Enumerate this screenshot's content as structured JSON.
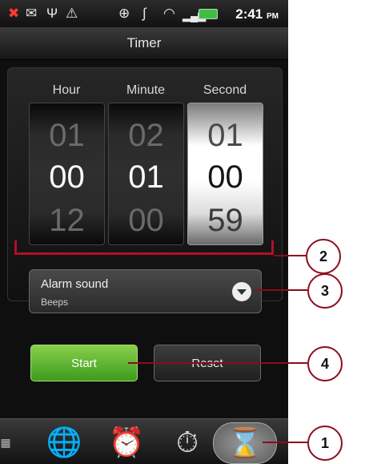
{
  "status_bar": {
    "time": "2:41",
    "ampm": "PM",
    "icons": [
      "missed-call-icon",
      "mail-icon",
      "usb-icon",
      "warning-icon",
      "gps-icon",
      "vibrate-icon",
      "wifi-icon",
      "signal-icon",
      "battery-icon"
    ]
  },
  "title": "Timer",
  "picker": {
    "columns": [
      {
        "label": "Hour",
        "above": "01",
        "value": "00",
        "below": "12"
      },
      {
        "label": "Minute",
        "above": "02",
        "value": "01",
        "below": "00"
      },
      {
        "label": "Second",
        "above": "01",
        "value": "00",
        "below": "59"
      }
    ]
  },
  "alarm": {
    "label": "Alarm sound",
    "value": "Beeps"
  },
  "buttons": {
    "start": "Start",
    "reset": "Reset"
  },
  "tabs": [
    "world-clock-icon",
    "alarm-clock-icon",
    "stopwatch-icon",
    "timer-hourglass-icon"
  ],
  "callouts": [
    "2",
    "3",
    "4",
    "1"
  ],
  "colors": {
    "accent_green": "#5cb82b",
    "callout_red": "#8c0c1c"
  }
}
